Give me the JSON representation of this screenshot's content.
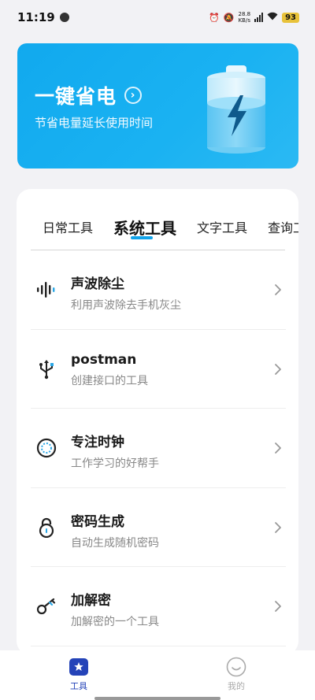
{
  "status_bar": {
    "time": "11:19",
    "net_speed_value": "28.8",
    "net_speed_unit": "KB/s",
    "battery": "93"
  },
  "banner": {
    "title": "一键省电",
    "subtitle": "节省电量延长使用时间",
    "bg_color": "#14adf0"
  },
  "tabs": [
    {
      "label": "日常工具",
      "active": false
    },
    {
      "label": "系统工具",
      "active": true
    },
    {
      "label": "文字工具",
      "active": false
    },
    {
      "label": "查询工具",
      "active": false
    }
  ],
  "tools": [
    {
      "name": "声波除尘",
      "desc": "利用声波除去手机灰尘",
      "icon": "sound-wave-icon"
    },
    {
      "name": "postman",
      "desc": "创建接口的工具",
      "icon": "usb-icon"
    },
    {
      "name": "专注时钟",
      "desc": "工作学习的好帮手",
      "icon": "focus-timer-icon"
    },
    {
      "name": "密码生成",
      "desc": "自动生成随机密码",
      "icon": "lock-icon"
    },
    {
      "name": "加解密",
      "desc": "加解密的一个工具",
      "icon": "key-icon"
    }
  ],
  "bottom_nav": {
    "tools_label": "工具",
    "mine_label": "我的",
    "active_color": "#2443b8"
  }
}
